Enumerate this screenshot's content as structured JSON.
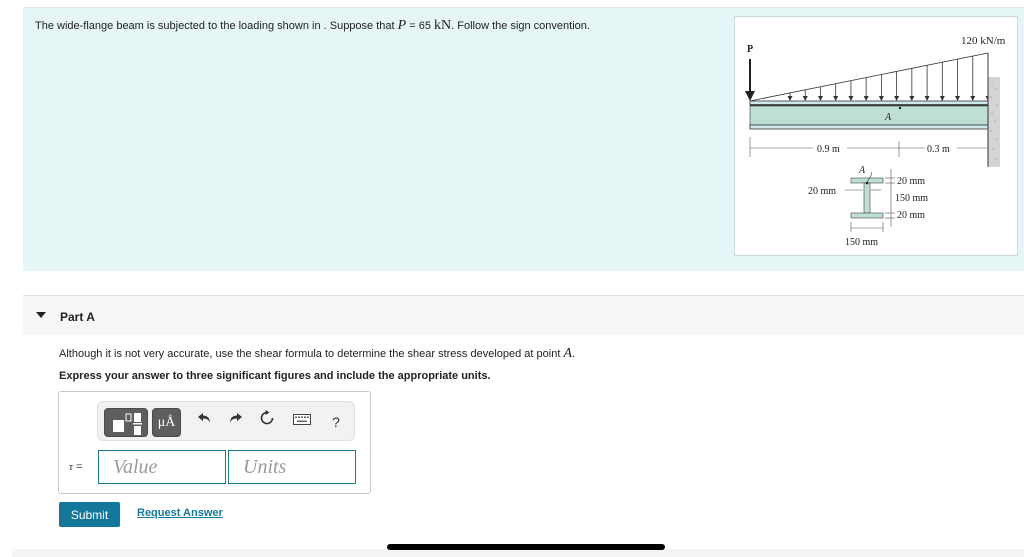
{
  "intro": {
    "text_before": "The wide-flange beam is subjected to the loading shown in . Suppose that ",
    "var_p": "P",
    "equals": " = 65 ",
    "unit": "kN",
    "text_after": ". Follow the sign convention."
  },
  "figure": {
    "label_p": "P",
    "label_load": "120 kN/m",
    "label_point_a": "A",
    "dim_left": "0.9 m",
    "dim_right": "0.3 m",
    "section_point_a": "A",
    "web_thickness": "20 mm",
    "top_flange": "20 mm",
    "web_height": "150 mm",
    "bottom_flange": "20 mm",
    "flange_width": "150 mm",
    "colors": {
      "beam_fill": "#bfded6",
      "flange_fill": "#cfe8ee",
      "wall": "#cccccc"
    }
  },
  "part": {
    "title": "Part A",
    "question_text": "Although it is not very accurate, use the shear formula to determine the shear stress developed at point ",
    "question_var": "A",
    "question_end": ".",
    "instruction": "Express your answer to three significant figures and include the appropriate units."
  },
  "answer": {
    "label_symbol": "τ",
    "label_eq": " =",
    "value_placeholder": "Value",
    "units_placeholder": "Units",
    "toolbar": {
      "templates_icon": "templates-icon",
      "units_label": "μÅ",
      "undo_icon": "↶",
      "redo_icon": "↷",
      "reset_icon": "↻",
      "keyboard_icon": "⌨",
      "help_label": "?"
    }
  },
  "actions": {
    "submit_label": "Submit",
    "request_answer_label": "Request Answer"
  },
  "colors": {
    "intro_bg": "#e6f5f6",
    "accent": "#14789a",
    "part_header_bg": "#f7f7f7"
  }
}
